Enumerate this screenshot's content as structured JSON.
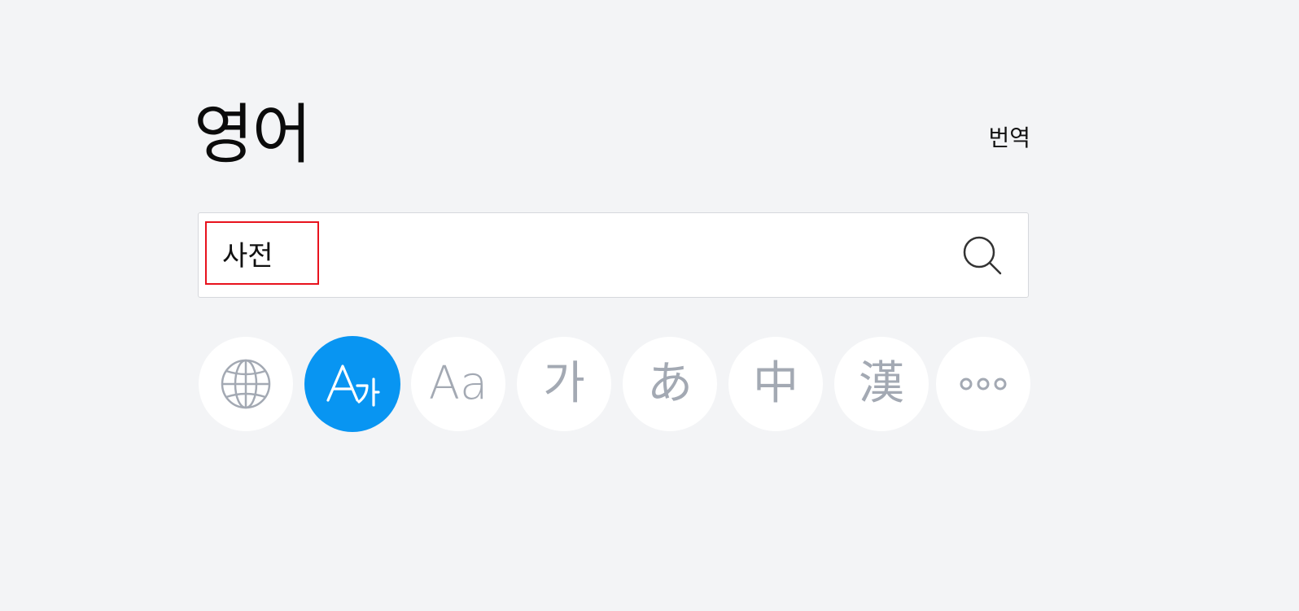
{
  "header": {
    "title": "영어",
    "translate_link": "번역"
  },
  "search": {
    "value": "사전",
    "button_icon": "search-icon"
  },
  "language_buttons": [
    {
      "icon": "globe-icon",
      "label": "",
      "active": false
    },
    {
      "icon": "english-korean-icon",
      "label": "",
      "active": true
    },
    {
      "icon": "english-icon",
      "label": "Aa",
      "active": false
    },
    {
      "icon": "korean-icon",
      "label": "가",
      "active": false
    },
    {
      "icon": "japanese-icon",
      "label": "あ",
      "active": false
    },
    {
      "icon": "chinese-icon",
      "label": "中",
      "active": false
    },
    {
      "icon": "hanja-icon",
      "label": "漢",
      "active": false
    },
    {
      "icon": "more-icon",
      "label": "",
      "active": false
    }
  ],
  "colors": {
    "background": "#f3f4f6",
    "accent": "#0895f2",
    "icon_gray": "#a3a9b3",
    "highlight_border": "#e8121d"
  }
}
